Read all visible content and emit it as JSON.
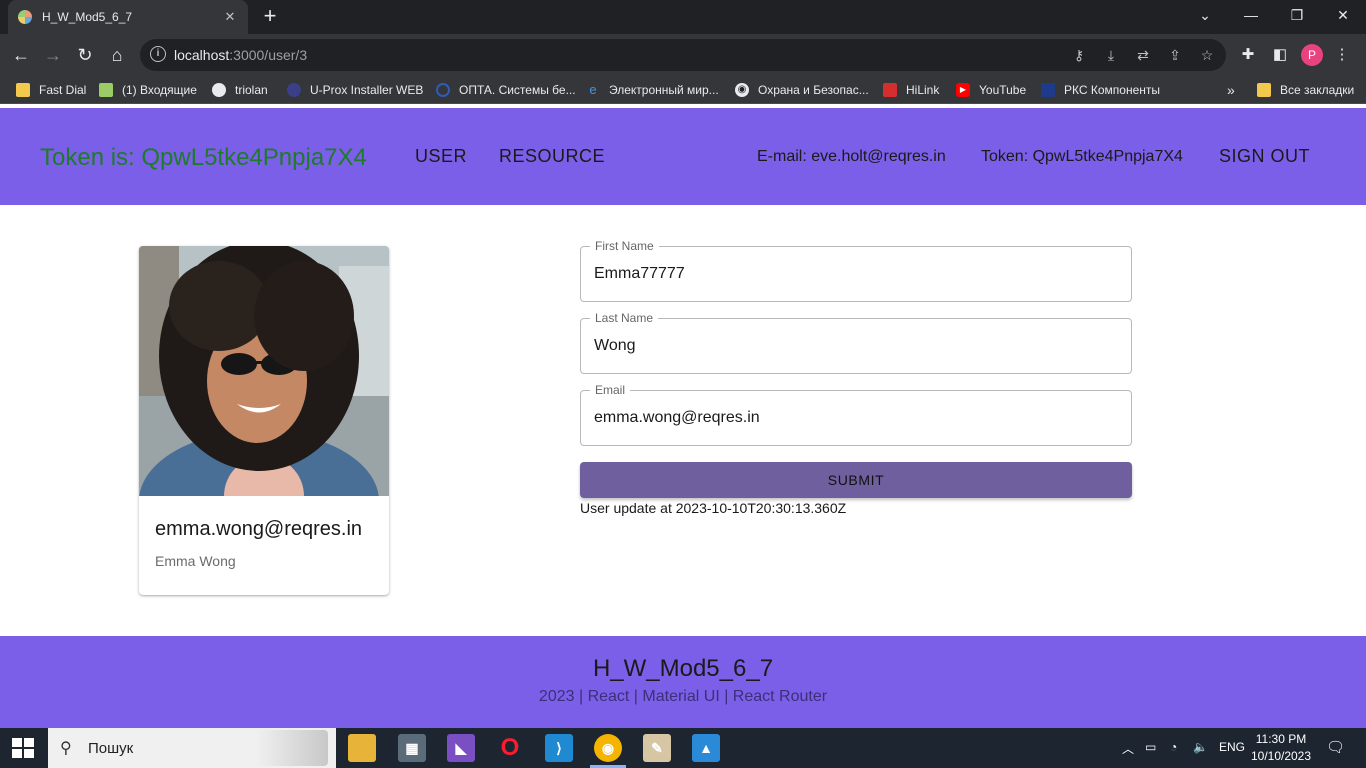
{
  "browser": {
    "tab_title": "H_W_Mod5_6_7",
    "tab_close": "✕",
    "new_tab": "+",
    "url_host": "localhost",
    "url_path": ":3000/user/3",
    "bookmarks": [
      {
        "label": "Fast Dial"
      },
      {
        "label": "(1) Входящие"
      },
      {
        "label": "triolan"
      },
      {
        "label": "U-Prox Installer WEB"
      },
      {
        "label": "ОПТА. Системы бе..."
      },
      {
        "label": "Электронный мир..."
      },
      {
        "label": "Охрана и Безопас..."
      },
      {
        "label": "HiLink"
      },
      {
        "label": "YouTube"
      },
      {
        "label": "РКС Компоненты"
      }
    ],
    "bookmarks_more": "»",
    "all_bookmarks": "Все закладки",
    "profile_initial": "P"
  },
  "header": {
    "token_title": "Token is: QpwL5tke4Pnpja7X4",
    "nav": [
      "USER",
      "RESOURCE"
    ],
    "email": "E-mail: eve.holt@reqres.in",
    "token": "Token: QpwL5tke4Pnpja7X4",
    "sign_out": "SIGN OUT"
  },
  "profile_card": {
    "email": "emma.wong@reqres.in",
    "name": "Emma Wong"
  },
  "form": {
    "first_name_label": "First Name",
    "first_name_value": "Emma77777",
    "last_name_label": "Last Name",
    "last_name_value": "Wong",
    "email_label": "Email",
    "email_value": "emma.wong@reqres.in",
    "submit_label": "SUBMIT",
    "update_message": "User update at 2023-10-10T20:30:13.360Z"
  },
  "footer": {
    "title": "H_W_Mod5_6_7",
    "subtitle": "2023 | React | Material UI | React Router"
  },
  "taskbar": {
    "search_placeholder": "Пошук",
    "language": "ENG",
    "time": "11:30 PM",
    "date": "10/10/2023"
  },
  "colors": {
    "appbar": "#7b5fe8",
    "token_title": "#1f7a2a",
    "submit": "#6f5f9e"
  }
}
